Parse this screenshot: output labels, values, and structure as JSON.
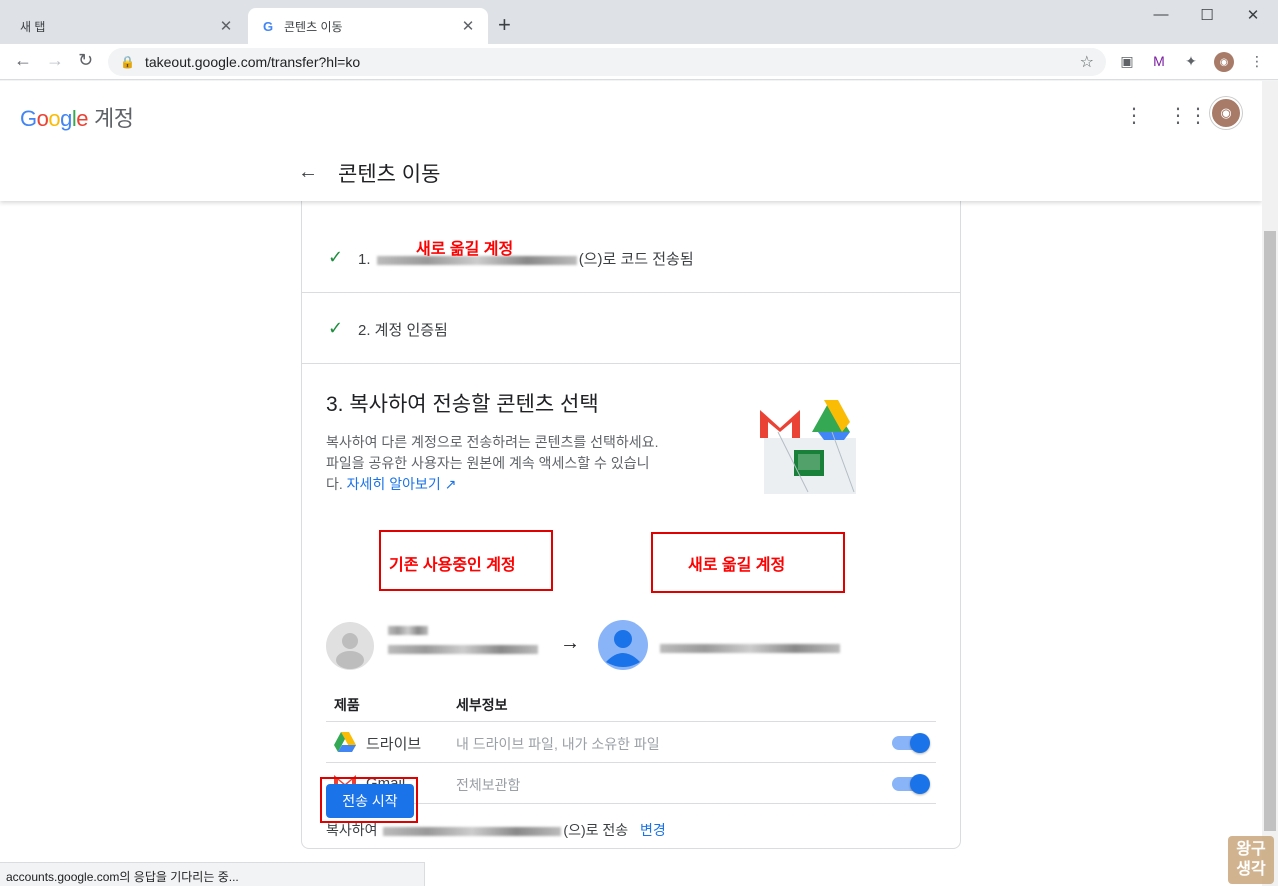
{
  "browser": {
    "tabs": [
      {
        "title": "새 탭",
        "active": false
      },
      {
        "title": "콘텐츠 이동",
        "active": true
      }
    ],
    "url": "takeout.google.com/transfer?hl=ko",
    "status_text": "accounts.google.com의 응답을 기다리는 중..."
  },
  "header": {
    "logo": "Google",
    "account_label": "계정",
    "page_title": "콘텐츠 이동"
  },
  "steps": {
    "step1_prefix": "1.",
    "step1_suffix": "(으)로 코드 전송됨",
    "step2": "2. 계정 인증됨",
    "step3_title": "3. 복사하여 전송할 콘텐츠 선택",
    "step3_desc": "복사하여 다른 계정으로 전송하려는 콘텐츠를 선택하세요. 파일을 공유한 사용자는 원본에 계속 액세스할 수 있습니다.",
    "learn_more": "자세히 알아보기"
  },
  "table": {
    "col_product": "제품",
    "col_details": "세부정보",
    "rows": [
      {
        "product": "드라이브",
        "details": "내 드라이브 파일, 내가 소유한 파일",
        "enabled": true
      },
      {
        "product": "Gmail",
        "details": "전체보관함",
        "enabled": true
      }
    ]
  },
  "copy_to": {
    "prefix": "복사하여",
    "suffix": "(으)로 전송",
    "change_link": "변경"
  },
  "start_button": "전송 시작",
  "annotations": {
    "new_account_1": "새로 옮길 계정",
    "existing_account": "기존 사용중인 계정",
    "new_account_2": "새로 옮길 계정"
  },
  "watermark": "왕구 생각",
  "colors": {
    "accent": "#1a73e8",
    "annotation": "#ff0000",
    "check": "#1e8e3e"
  }
}
